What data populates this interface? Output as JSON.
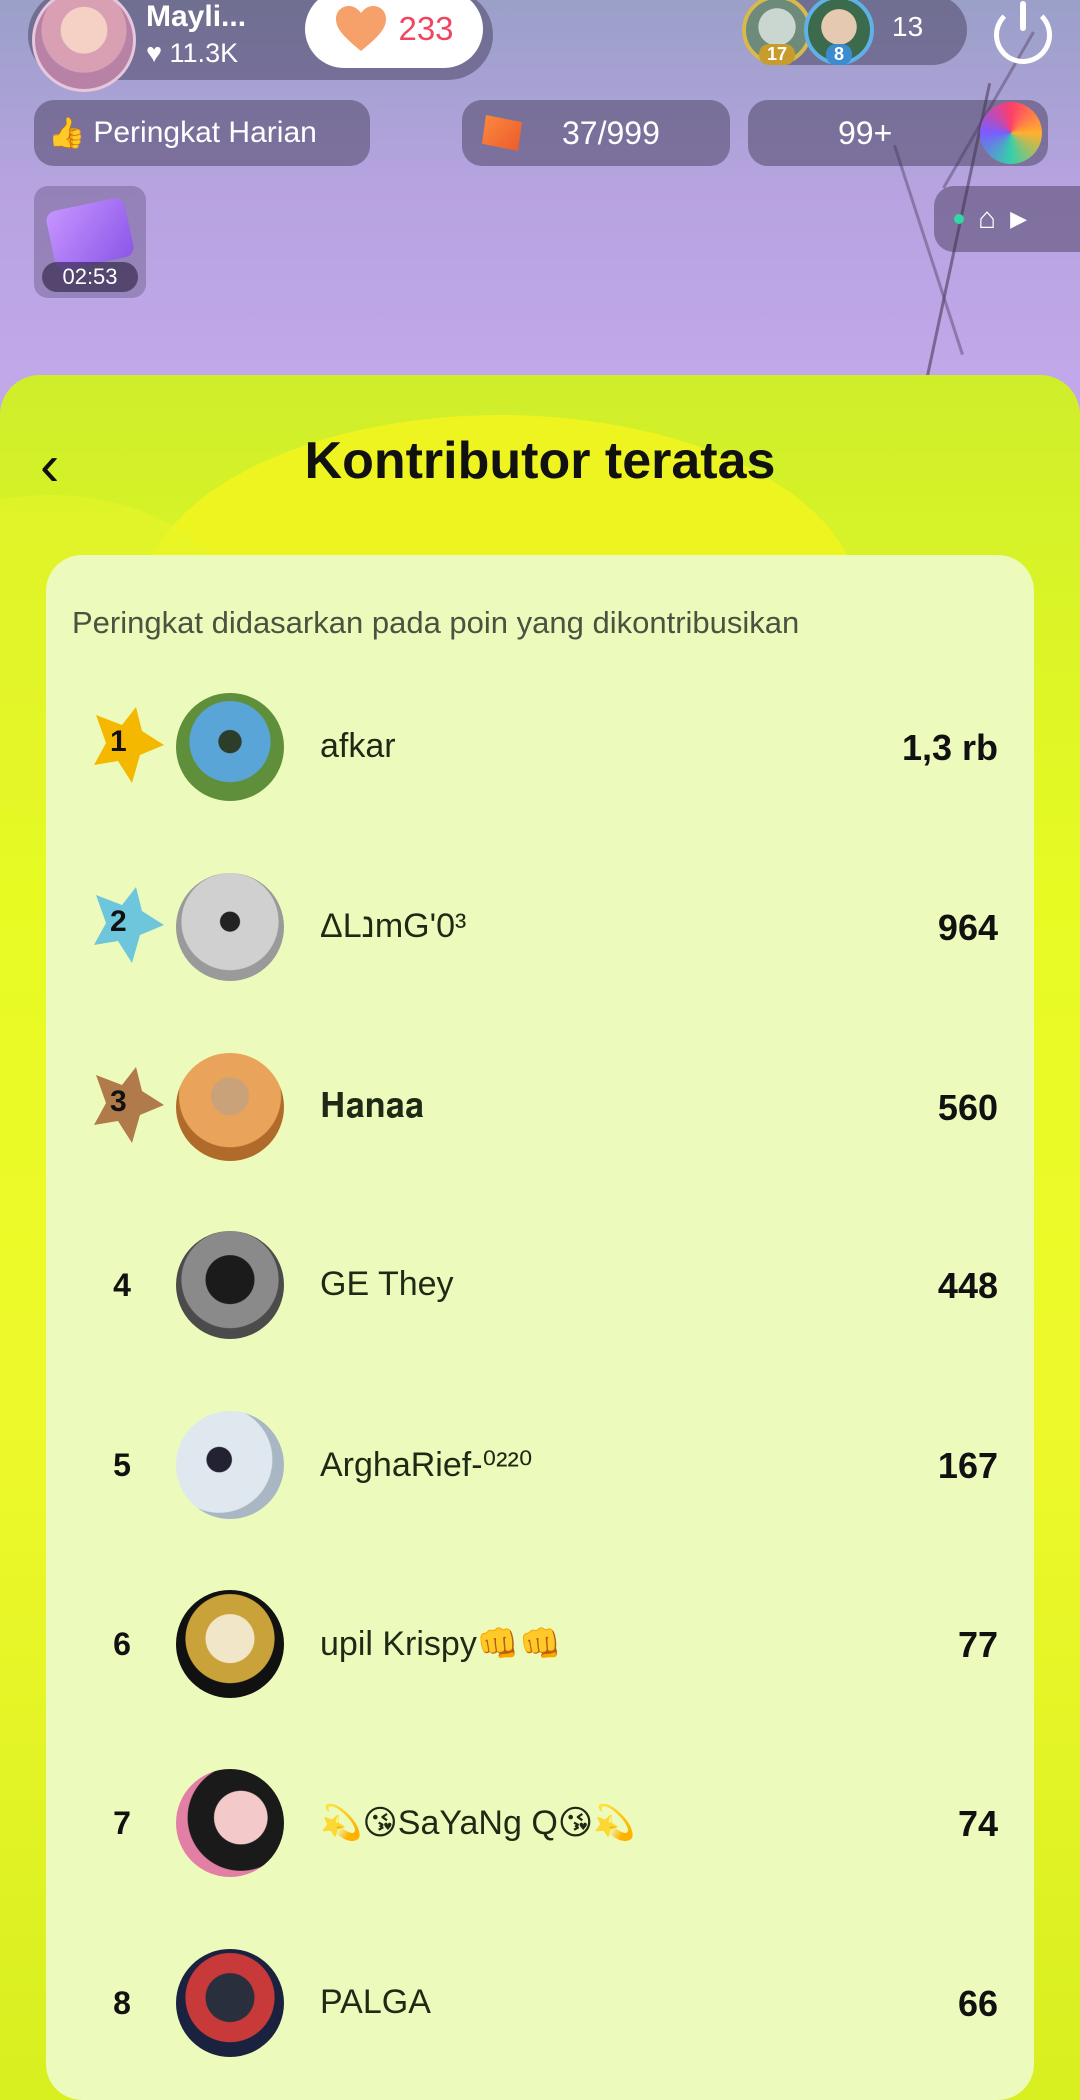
{
  "header": {
    "host_name": "Mayli...",
    "host_likes": "♥ 11.3K",
    "follow_count": "233",
    "viewer_badges": [
      "17",
      "8"
    ],
    "viewer_count": "13"
  },
  "toolbar": {
    "daily_rank_label": "Peringkat Harian",
    "tickets": "37/999",
    "gifts": "99+",
    "gift_timer": "02:53"
  },
  "sheet": {
    "title": "Kontributor teratas",
    "subtitle": "Peringkat didasarkan pada poin yang dikontribusikan",
    "back_icon": "chevron-left-icon"
  },
  "contributors": [
    {
      "rank": "1",
      "name": "afkar",
      "score": "1,3 rb"
    },
    {
      "rank": "2",
      "name": "ΔLנmG'0³",
      "score": "964"
    },
    {
      "rank": "3",
      "name": "𝐇𝐚𝐧𝐚𝐚",
      "score": "560"
    },
    {
      "rank": "4",
      "name": "GE They",
      "score": "448"
    },
    {
      "rank": "5",
      "name": "ArghaRief-⁰²²⁰",
      "score": "167"
    },
    {
      "rank": "6",
      "name": "upil Krispy👊👊",
      "score": "77"
    },
    {
      "rank": "7",
      "name": "💫😘SaYaNg Q😘💫",
      "score": "74"
    },
    {
      "rank": "8",
      "name": "PALGA",
      "score": "66"
    }
  ],
  "colors": {
    "gold": "#f5b800",
    "silver": "#6ec6dc",
    "bronze": "#b07a4a",
    "sheet": "#e7fb23",
    "card": "#ecfbbb"
  }
}
